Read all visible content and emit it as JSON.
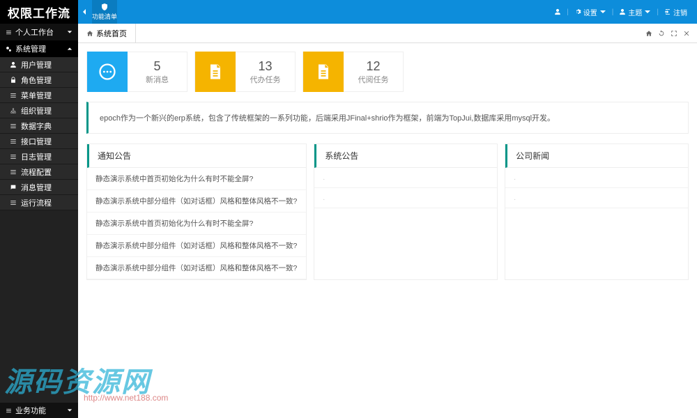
{
  "header": {
    "logo": "权限工作流",
    "func_menu": "功能清单",
    "user_icon": "user",
    "settings": "设置",
    "theme": "主题",
    "logout": "注销"
  },
  "sidebar": {
    "section1": "个人工作台",
    "section2": "系统管理",
    "items": [
      {
        "icon": "user",
        "label": "用户管理"
      },
      {
        "icon": "lock",
        "label": "角色管理"
      },
      {
        "icon": "list",
        "label": "菜单管理"
      },
      {
        "icon": "org",
        "label": "组织管理"
      },
      {
        "icon": "list",
        "label": "数据字典"
      },
      {
        "icon": "list",
        "label": "接口管理"
      },
      {
        "icon": "list",
        "label": "日志管理"
      },
      {
        "icon": "list",
        "label": "流程配置"
      },
      {
        "icon": "msg",
        "label": "消息管理"
      },
      {
        "icon": "list",
        "label": "运行流程"
      }
    ],
    "bottom": "业务功能"
  },
  "tabs": {
    "home": "系统首页"
  },
  "stats": [
    {
      "color": "blue",
      "icon": "chat",
      "num": "5",
      "label": "新消息"
    },
    {
      "color": "orange",
      "icon": "doc",
      "num": "13",
      "label": "代办任务"
    },
    {
      "color": "orange",
      "icon": "doc",
      "num": "12",
      "label": "代阅任务"
    }
  ],
  "banner": "epoch作为一个新兴的erp系统，包含了传统框架的一系列功能，后端采用JFinal+shrio作为框架，前端为TopJui,数据库采用mysql开发。",
  "panels": [
    {
      "title": "通知公告",
      "rows": [
        "静态演示系统中首页初始化为什么有时不能全屏?",
        "静态演示系统中部分组件（如对话框）风格和整体风格不一致?",
        "静态演示系统中首页初始化为什么有时不能全屏?",
        "静态演示系统中部分组件（如对话框）风格和整体风格不一致?",
        "静态演示系统中部分组件（如对话框）风格和整体风格不一致?"
      ]
    },
    {
      "title": "系统公告",
      "rows": [
        ".",
        "."
      ]
    },
    {
      "title": "公司新闻",
      "rows": [
        ".",
        "."
      ]
    }
  ],
  "watermark": "源码资源网",
  "watermark_url": "http://www.net188.com"
}
